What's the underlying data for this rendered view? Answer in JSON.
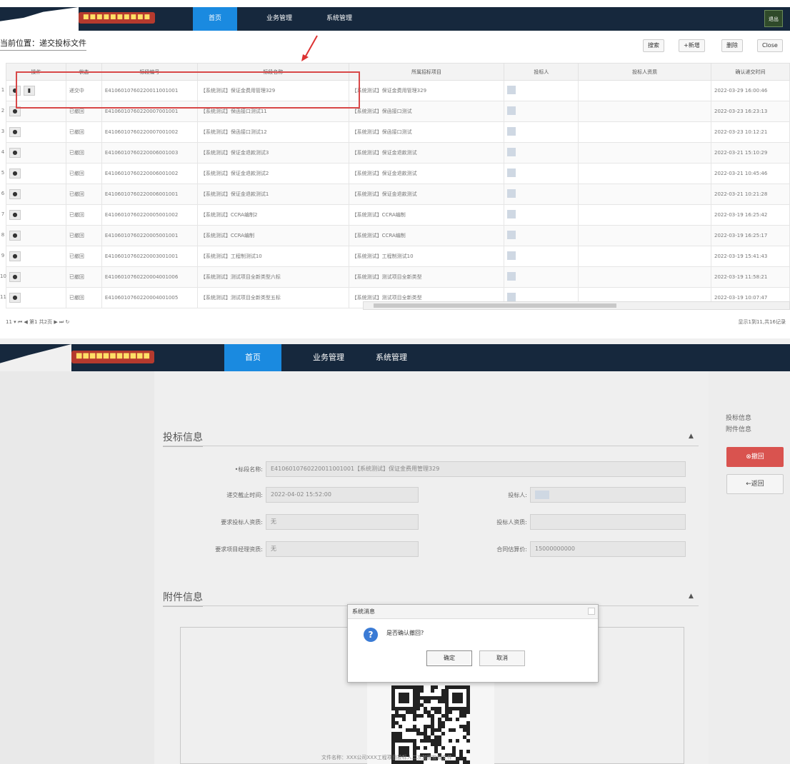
{
  "top": {
    "nav": {
      "logo": "■■■■■■■■■■",
      "tabs": [
        "首页",
        "业务管理",
        "系统管理"
      ],
      "user_label": "退出"
    },
    "breadcrumb": "当前位置：递交投标文件",
    "toolbar": [
      "搜索",
      "+新增",
      "删除",
      "Close"
    ],
    "columns": [
      "操作",
      "状态",
      "标段编号",
      "标段名称",
      "所属招标项目",
      "投标人",
      "投标人资质",
      "确认递交时间"
    ],
    "rows": [
      {
        "num": "1",
        "status": "递交中",
        "code": "E4106010760220011001001",
        "name": "【系统测试】保证金费用管理329",
        "project": "【系统测试】保证金费用管理329",
        "time": "2022-03-29 16:00:46"
      },
      {
        "num": "2",
        "status": "已撤回",
        "code": "E4106010760220007001001",
        "name": "【系统测试】保函接口测试11",
        "project": "【系统测试】保函接口测试",
        "time": "2022-03-23 16:23:13"
      },
      {
        "num": "3",
        "status": "已撤回",
        "code": "E4106010760220007001002",
        "name": "【系统测试】保函接口测试12",
        "project": "【系统测试】保函接口测试",
        "time": "2022-03-23 10:12:21"
      },
      {
        "num": "4",
        "status": "已撤回",
        "code": "E4106010760220006001003",
        "name": "【系统测试】保证金退款测试3",
        "project": "【系统测试】保证金退款测试",
        "time": "2022-03-21 15:10:29"
      },
      {
        "num": "5",
        "status": "已撤回",
        "code": "E4106010760220006001002",
        "name": "【系统测试】保证金退款测试2",
        "project": "【系统测试】保证金退款测试",
        "time": "2022-03-21 10:45:46"
      },
      {
        "num": "6",
        "status": "已撤回",
        "code": "E4106010760220006001001",
        "name": "【系统测试】保证金退款测试1",
        "project": "【系统测试】保证金退款测试",
        "time": "2022-03-21 10:21:28"
      },
      {
        "num": "7",
        "status": "已撤回",
        "code": "E4106010760220005001002",
        "name": "【系统测试】CCRA编制2",
        "project": "【系统测试】CCRA编制",
        "time": "2022-03-19 16:25:42"
      },
      {
        "num": "8",
        "status": "已撤回",
        "code": "E4106010760220005001001",
        "name": "【系统测试】CCRA编制",
        "project": "【系统测试】CCRA编制",
        "time": "2022-03-19 16:25:17"
      },
      {
        "num": "9",
        "status": "已撤回",
        "code": "E4106010760220003001001",
        "name": "【系统测试】工程制测试10",
        "project": "【系统测试】工程制测试10",
        "time": "2022-03-19 15:41:43"
      },
      {
        "num": "10",
        "status": "已撤回",
        "code": "E4106010760220004001006",
        "name": "【系统测试】测试项目全新类型六标",
        "project": "【系统测试】测试项目全新类型",
        "time": "2022-03-19 11:58:21"
      },
      {
        "num": "11",
        "status": "已撤回",
        "code": "E4106010760220004001005",
        "name": "【系统测试】测试项目全新类型五标",
        "project": "【系统测试】测试项目全新类型",
        "time": "2022-03-19 10:07:47"
      }
    ],
    "pager": "11 ▾  ⏮ ◀  第1  共2页  ▶ ⏭  ↻",
    "pageinfo": "显示1到11,共16记录"
  },
  "bottom": {
    "nav": {
      "logo": "■■■■■■■■■■■",
      "tabs": [
        "首页",
        "业务管理",
        "系统管理"
      ]
    },
    "bid_info_title": "投标信息",
    "fields": {
      "section_name_label": "•标段名称:",
      "section_name_value": "E4106010760220011001001【系统测试】保证金费用管理329",
      "deadline_label": "递交截止时间:",
      "deadline_value": "2022-04-02 15:52:00",
      "bidder_label": "投标人:",
      "req_qual_label": "要求投标人资质:",
      "req_qual_value": "无",
      "bidder_qual_label": "投标人资质:",
      "req_exp_label": "要求项目经理资质:",
      "req_exp_value": "无",
      "price_label": "合同估算价:",
      "price_value": "15000000000"
    },
    "attach_title": "附件信息",
    "side_links": [
      "投标信息",
      "附件信息"
    ],
    "withdraw_label": "⊗撤回",
    "back_label": "←返回",
    "caption": "文件名称：XXX公司XXX工程项目投标人二次加密投标文件",
    "dialog": {
      "title": "系统消息",
      "message": "是否确认撤回?",
      "ok": "确定",
      "cancel": "取消"
    }
  }
}
